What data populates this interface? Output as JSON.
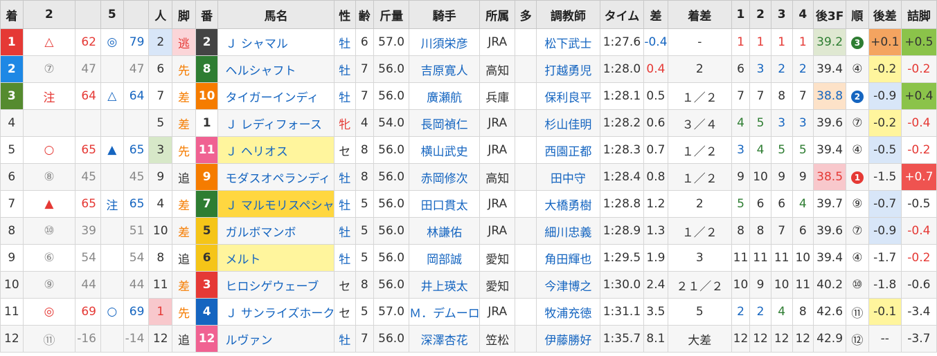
{
  "columns": [
    "着",
    "2",
    "",
    "5",
    "",
    "人",
    "脚",
    "番",
    "馬名",
    "性",
    "齢",
    "斤量",
    "騎手",
    "所属",
    "多",
    "調教師",
    "タイム",
    "差",
    "着差",
    "1",
    "2",
    "3",
    "4",
    "後3F",
    "順",
    "後差",
    "詰脚"
  ],
  "rows": [
    {
      "着": "1",
      "m2": "△",
      "v2": "62",
      "m5": "◎",
      "v5": "79",
      "人": "2",
      "脚": "逃",
      "番": "2",
      "馬名": "Ｊ シャマル",
      "性": "牡",
      "齢": "6",
      "斤量": "57.0",
      "騎手": "川須栄彦",
      "所属": "JRA",
      "多": "",
      "調教師": "松下武士",
      "タイム": "1:27.6",
      "差": "-0.4",
      "着差": "-",
      "c1": "1",
      "c2": "1",
      "c3": "1",
      "c4": "1",
      "後3F": "39.2",
      "順": "3",
      "後差": "+0.1",
      "詰脚": "+0.5"
    },
    {
      "着": "2",
      "m2": "⑦",
      "v2": "47",
      "m5": "",
      "v5": "47",
      "人": "6",
      "脚": "先",
      "番": "8",
      "馬名": "ヘルシャフト",
      "性": "牡",
      "齢": "7",
      "斤量": "56.0",
      "騎手": "吉原寛人",
      "所属": "高知",
      "多": "",
      "調教師": "打越勇児",
      "タイム": "1:28.0",
      "差": "0.4",
      "着差": "2",
      "c1": "6",
      "c2": "3",
      "c3": "2",
      "c4": "2",
      "後3F": "39.4",
      "順": "④",
      "後差": "-0.2",
      "詰脚": "-0.2"
    },
    {
      "着": "3",
      "m2": "注",
      "v2": "64",
      "m5": "△",
      "v5": "64",
      "人": "7",
      "脚": "差",
      "番": "10",
      "馬名": "タイガーインディ",
      "性": "牡",
      "齢": "7",
      "斤量": "56.0",
      "騎手": "廣瀬航",
      "所属": "兵庫",
      "多": "",
      "調教師": "保利良平",
      "タイム": "1:28.1",
      "差": "0.5",
      "着差": "１／２",
      "c1": "7",
      "c2": "7",
      "c3": "8",
      "c4": "7",
      "後3F": "38.8",
      "順": "2",
      "後差": "-0.9",
      "詰脚": "+0.4"
    },
    {
      "着": "4",
      "m2": "",
      "v2": "",
      "m5": "",
      "v5": "",
      "人": "5",
      "脚": "差",
      "番": "1",
      "馬名": "Ｊ レディフォース",
      "性": "牝",
      "齢": "4",
      "斤量": "54.0",
      "騎手": "長岡禎仁",
      "所属": "JRA",
      "多": "",
      "調教師": "杉山佳明",
      "タイム": "1:28.2",
      "差": "0.6",
      "着差": "３／４",
      "c1": "4",
      "c2": "5",
      "c3": "3",
      "c4": "3",
      "後3F": "39.6",
      "順": "⑦",
      "後差": "-0.2",
      "詰脚": "-0.4"
    },
    {
      "着": "5",
      "m2": "○",
      "v2": "65",
      "m5": "▲",
      "v5": "65",
      "人": "3",
      "脚": "先",
      "番": "11",
      "馬名": "Ｊ ヘリオス",
      "性": "セ",
      "齢": "8",
      "斤量": "56.0",
      "騎手": "横山武史",
      "所属": "JRA",
      "多": "",
      "調教師": "西園正都",
      "タイム": "1:28.3",
      "差": "0.7",
      "着差": "１／２",
      "c1": "3",
      "c2": "4",
      "c3": "5",
      "c4": "5",
      "後3F": "39.4",
      "順": "④",
      "後差": "-0.5",
      "詰脚": "-0.2"
    },
    {
      "着": "6",
      "m2": "⑧",
      "v2": "45",
      "m5": "",
      "v5": "45",
      "人": "9",
      "脚": "追",
      "番": "9",
      "馬名": "モダスオペランディ",
      "性": "牡",
      "齢": "8",
      "斤量": "56.0",
      "騎手": "赤岡修次",
      "所属": "高知",
      "多": "",
      "調教師": "田中守",
      "タイム": "1:28.4",
      "差": "0.8",
      "着差": "１／２",
      "c1": "9",
      "c2": "10",
      "c3": "9",
      "c4": "9",
      "後3F": "38.5",
      "順": "1",
      "後差": "-1.5",
      "詰脚": "+0.7"
    },
    {
      "着": "7",
      "m2": "▲",
      "v2": "65",
      "m5": "注",
      "v5": "65",
      "人": "4",
      "脚": "差",
      "番": "7",
      "馬名": "Ｊ マルモリスペシャル",
      "性": "牡",
      "齢": "5",
      "斤量": "56.0",
      "騎手": "田口貫太",
      "所属": "JRA",
      "多": "",
      "調教師": "大橋勇樹",
      "タイム": "1:28.8",
      "差": "1.2",
      "着差": "2",
      "c1": "5",
      "c2": "6",
      "c3": "6",
      "c4": "4",
      "後3F": "39.7",
      "順": "⑨",
      "後差": "-0.7",
      "詰脚": "-0.5"
    },
    {
      "着": "8",
      "m2": "⑩",
      "v2": "39",
      "m5": "",
      "v5": "51",
      "人": "10",
      "脚": "差",
      "番": "5",
      "馬名": "ガルボマンボ",
      "性": "牡",
      "齢": "5",
      "斤量": "56.0",
      "騎手": "林謙佑",
      "所属": "JRA",
      "多": "",
      "調教師": "細川忠義",
      "タイム": "1:28.9",
      "差": "1.3",
      "着差": "１／２",
      "c1": "8",
      "c2": "8",
      "c3": "7",
      "c4": "6",
      "後3F": "39.6",
      "順": "⑦",
      "後差": "-0.9",
      "詰脚": "-0.4"
    },
    {
      "着": "9",
      "m2": "⑥",
      "v2": "54",
      "m5": "",
      "v5": "54",
      "人": "8",
      "脚": "追",
      "番": "6",
      "馬名": "メルト",
      "性": "牡",
      "齢": "5",
      "斤量": "56.0",
      "騎手": "岡部誠",
      "所属": "愛知",
      "多": "",
      "調教師": "角田輝也",
      "タイム": "1:29.5",
      "差": "1.9",
      "着差": "3",
      "c1": "11",
      "c2": "11",
      "c3": "11",
      "c4": "10",
      "後3F": "39.4",
      "順": "④",
      "後差": "-1.7",
      "詰脚": "-0.2"
    },
    {
      "着": "10",
      "m2": "⑨",
      "v2": "44",
      "m5": "",
      "v5": "44",
      "人": "11",
      "脚": "差",
      "番": "3",
      "馬名": "ヒロシゲウェーブ",
      "性": "セ",
      "齢": "8",
      "斤量": "56.0",
      "騎手": "井上瑛太",
      "所属": "愛知",
      "多": "",
      "調教師": "今津博之",
      "タイム": "1:30.0",
      "差": "2.4",
      "着差": "２１／２",
      "c1": "10",
      "c2": "9",
      "c3": "10",
      "c4": "11",
      "後3F": "40.2",
      "順": "⑩",
      "後差": "-1.8",
      "詰脚": "-0.6"
    },
    {
      "着": "11",
      "m2": "◎",
      "v2": "69",
      "m5": "○",
      "v5": "69",
      "人": "1",
      "脚": "先",
      "番": "4",
      "馬名": "Ｊ サンライズホーク",
      "性": "セ",
      "齢": "5",
      "斤量": "57.0",
      "騎手": "Ｍ．デムーロ",
      "所属": "JRA",
      "多": "",
      "調教師": "牧浦充徳",
      "タイム": "1:31.1",
      "差": "3.5",
      "着差": "5",
      "c1": "2",
      "c2": "2",
      "c3": "4",
      "c4": "8",
      "後3F": "42.6",
      "順": "⑪",
      "後差": "-0.1",
      "詰脚": "-3.4"
    },
    {
      "着": "12",
      "m2": "⑪",
      "v2": "-16",
      "m5": "",
      "v5": "-14",
      "人": "12",
      "脚": "追",
      "番": "12",
      "馬名": "ルヴァン",
      "性": "牡",
      "齢": "7",
      "斤量": "56.0",
      "騎手": "深澤杏花",
      "所属": "笠松",
      "多": "",
      "調教師": "伊藤勝好",
      "タイム": "1:35.7",
      "差": "8.1",
      "着差": "大差",
      "c1": "12",
      "c2": "12",
      "c3": "12",
      "c4": "12",
      "後3F": "42.9",
      "順": "⑫",
      "後差": "--",
      "詰脚": "-3.7"
    }
  ],
  "colors": {
    "rank1": "#e53935",
    "rank2": "#1e88e5",
    "rank3": "#558b2f",
    "gate_white": "#ffffff",
    "gate_black": "#444444",
    "gate_red": "#e53935",
    "gate_blue": "#1565c0",
    "gate_yellow": "#f5c518",
    "gate_green": "#2e7d32",
    "gate_orange": "#f57c00",
    "gate_pink": "#f06292",
    "highlight_yellow": "#fff59d",
    "highlight_orange": "#f4a460",
    "highlight_green": "#8bc34a",
    "highlight_red": "#ef5350",
    "highlight_blue_soft": "#d8e6f8",
    "highlight_peach": "#fde2c8",
    "highlight_pink": "#f8c8cc",
    "highlight_pink_soft": "#fbd5d8"
  }
}
